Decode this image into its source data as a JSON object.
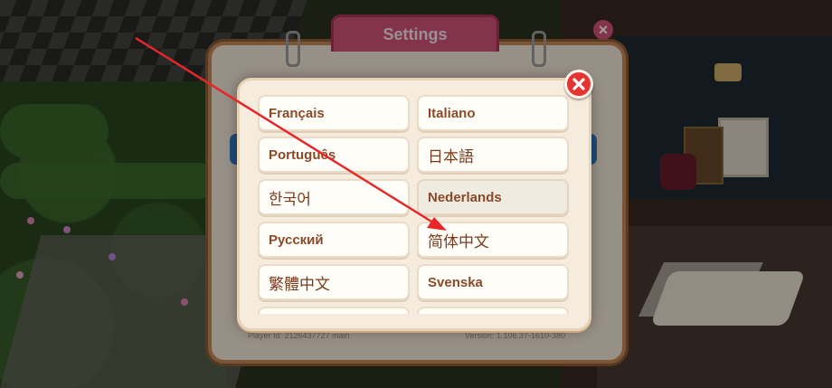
{
  "settings": {
    "title": "Settings",
    "player_id": "Player Id: 2126437727 main",
    "version": "Version: 1.106.37-1610-380"
  },
  "language_popup": {
    "languages": [
      {
        "label": "Français",
        "cjk": false
      },
      {
        "label": "Italiano",
        "cjk": false
      },
      {
        "label": "Português",
        "cjk": false
      },
      {
        "label": "日本語",
        "cjk": true
      },
      {
        "label": "한국어",
        "cjk": true
      },
      {
        "label": "Nederlands",
        "cjk": false,
        "selected": true
      },
      {
        "label": "Русский",
        "cjk": false
      },
      {
        "label": "简体中文",
        "cjk": true
      },
      {
        "label": "繁體中文",
        "cjk": true
      },
      {
        "label": "Svenska",
        "cjk": false
      },
      {
        "label": "",
        "cjk": false
      },
      {
        "label": "",
        "cjk": false
      }
    ],
    "close_icon": "close-x-icon"
  },
  "annotation": {
    "color": "#e8262a",
    "points_to": "简体中文"
  },
  "colors": {
    "popup_bg": "#f6ecde",
    "item_text": "#8a4a2a",
    "close_red": "#e53431",
    "settings_tab": "#d3537a"
  }
}
